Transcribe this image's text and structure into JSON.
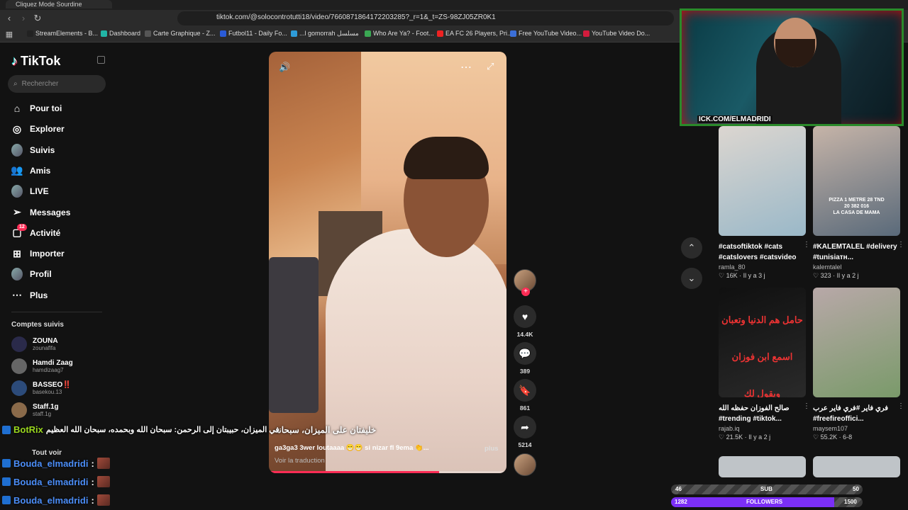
{
  "browser": {
    "tab_title": "Cliquez Mode Sourdine",
    "url": "tiktok.com/@solocontrotutti18/video/7660871864172203285?_r=1&_t=ZS-98ZJ05ZR0K1",
    "bookmarks": [
      {
        "label": "StreamElements - B...",
        "color": "#222"
      },
      {
        "label": "Dashboard",
        "color": "#21b5a5"
      },
      {
        "label": "Carte Graphique - Z...",
        "color": "#555"
      },
      {
        "label": "Futbol11 - Daily Fo...",
        "color": "#2a5bd7"
      },
      {
        "label": "...l gomorrah مسلسل",
        "color": "#2e9bd8"
      },
      {
        "label": "Who Are Ya? - Foot...",
        "color": "#3aa853"
      },
      {
        "label": "EA FC 26 Players, Pri...",
        "color": "#e22"
      },
      {
        "label": "Free YouTube Video...",
        "color": "#3b6fd8"
      },
      {
        "label": "YouTube Video Do...",
        "color": "#d31c3d"
      }
    ]
  },
  "tiktok": {
    "logo": "TikTok",
    "search_placeholder": "Rechercher",
    "nav": [
      {
        "label": "Pour toi",
        "icon": "home-icon"
      },
      {
        "label": "Explorer",
        "icon": "compass-icon"
      },
      {
        "label": "Suivis",
        "icon": "following-avatar"
      },
      {
        "label": "Amis",
        "icon": "friends-icon"
      },
      {
        "label": "LIVE",
        "icon": "live-avatar"
      },
      {
        "label": "Messages",
        "icon": "send-icon"
      },
      {
        "label": "Activité",
        "icon": "inbox-icon",
        "badge": "12"
      },
      {
        "label": "Importer",
        "icon": "plus-square-icon"
      },
      {
        "label": "Profil",
        "icon": "profile-avatar"
      },
      {
        "label": "Plus",
        "icon": "more-icon"
      }
    ],
    "followed_title": "Comptes suivis",
    "followed": [
      {
        "name": "ZOUNA",
        "user": "zounaflfa",
        "color": "#2a2a4a"
      },
      {
        "name": "Hamdi Zaag",
        "user": "hamdizaag7",
        "color": "#666"
      },
      {
        "name": "BASSEO‼️",
        "user": "basekou.13",
        "color": "#2c4b7a"
      },
      {
        "name": "Staff.1g",
        "user": "staff.1g",
        "color": "#8a6a4a"
      }
    ],
    "see_all": "Tout voir"
  },
  "video": {
    "subtitle": "خليفتان على الميزان، سبحانه",
    "caption": "ga3ga3 3wer loutaaaa 😁😁 si nizar fl 9ema 👏...",
    "more": "plus",
    "translate": "Voir la traduction",
    "progress": 0.715,
    "actions": {
      "likes": "14.4K",
      "comments": "389",
      "saves": "861",
      "shares": "5214"
    }
  },
  "recommended": [
    {
      "title": "#catsoftiktok #cats #catslovers #catsvideo",
      "author": "ramla_80",
      "likes": "16K",
      "time": "Il y a 3 j",
      "palette": [
        "#dcd6d0",
        "#9ab8c8"
      ]
    },
    {
      "title": "#KALEMTALEL #delivery #tunisiaтн...",
      "author": "kalemtalel",
      "likes": "323",
      "time": "Il y a 2 j",
      "palette": [
        "#c6b4a8",
        "#5a6a7a"
      ],
      "thumb_text": "PIZZA 1 METRE 28 TND\n20 382 016\nLA CASA DE MAMA"
    },
    {
      "title": "صالح الفوزان حفظه الله\n#trending #tiktok...",
      "author": "rajab.iq",
      "likes": "21.5K",
      "time": "Il y a 2 j",
      "palette": [
        "#101010",
        "#2a2a2a"
      ],
      "thumb_text": "حامل هم الدنيا وتعبان\nاسمع ابن فوزان ويقول لك"
    },
    {
      "title": "فري فاير #فري فاير عرب\n#freefireoffici...",
      "author": "maysem107",
      "likes": "55.2K",
      "time": "6-8",
      "palette": [
        "#b8a8a8",
        "#7a9a6a"
      ]
    }
  ],
  "stream": {
    "cam_label": "ICK.COM/ELMADRIDI",
    "chat": [
      {
        "user": "BotRix",
        "message": "في الميزان، حبيبتان إلى الرحمن: سبحان الله وبحمده، سبحان الله العظيم"
      },
      {
        "user": "Bouda_elmadridi",
        "message": ":"
      },
      {
        "user": "Bouda_elmadridi",
        "message": ":"
      },
      {
        "user": "Bouda_elmadridi",
        "message": ":"
      }
    ],
    "sub_goal": {
      "label": "SUB",
      "current": "46",
      "target": "50",
      "progress": 0.92
    },
    "follower_goal": {
      "label": "FOLLOWERS",
      "current": "1282",
      "target": "1500",
      "progress": 0.85
    }
  }
}
